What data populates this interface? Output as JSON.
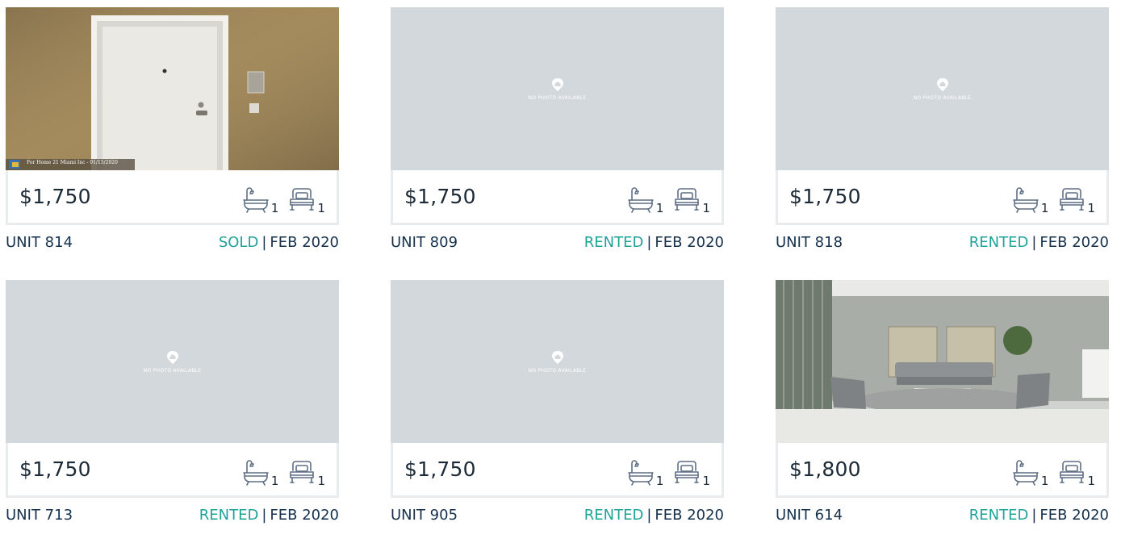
{
  "listings": [
    {
      "photo": "door",
      "price": "$1,750",
      "baths": "1",
      "beds": "1",
      "unit": "UNIT 814",
      "status": "SOLD",
      "date": "FEB 2020",
      "photo_caption": "For Home 21 Miami Inc - 01/15/2020"
    },
    {
      "photo": "none",
      "price": "$1,750",
      "baths": "1",
      "beds": "1",
      "unit": "UNIT 809",
      "status": "RENTED",
      "date": "FEB 2020"
    },
    {
      "photo": "none",
      "price": "$1,750",
      "baths": "1",
      "beds": "1",
      "unit": "UNIT 818",
      "status": "RENTED",
      "date": "FEB 2020"
    },
    {
      "photo": "none",
      "price": "$1,750",
      "baths": "1",
      "beds": "1",
      "unit": "UNIT 713",
      "status": "RENTED",
      "date": "FEB 2020"
    },
    {
      "photo": "none",
      "price": "$1,750",
      "baths": "1",
      "beds": "1",
      "unit": "UNIT 905",
      "status": "RENTED",
      "date": "FEB 2020"
    },
    {
      "photo": "lounge",
      "price": "$1,800",
      "baths": "1",
      "beds": "1",
      "unit": "UNIT 614",
      "status": "RENTED",
      "date": "FEB 2020"
    }
  ],
  "no_photo_label": "NO PHOTO AVAILABLE",
  "separator": "|",
  "colors": {
    "status": "#1fa398",
    "placeholder_bg": "#d3d8dc",
    "text": "#15314d"
  },
  "icons": {
    "bath": "bathtub-icon",
    "bed": "bed-icon",
    "no_photo": "house-pin-icon"
  }
}
